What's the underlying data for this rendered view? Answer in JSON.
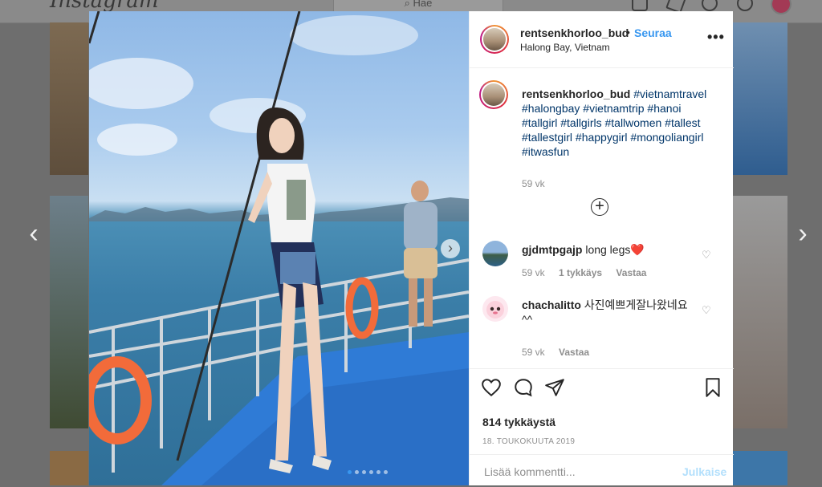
{
  "app": {
    "logo": "Instagram",
    "search_placeholder": "Hae"
  },
  "post": {
    "author": "rentsenkhorloo_bud",
    "follow_label": "Seuraa",
    "separator": "•",
    "location": "Halong Bay, Vietnam",
    "more_label": "•••",
    "carousel": {
      "total": 6,
      "active_index": 0
    },
    "caption": {
      "username": "rentsenkhorloo_bud",
      "hashtags": "#vietnamtravel #halongbay #vietnamtrip #hanoi #tallgirl #tallgirls #tallwomen #tallest #tallestgirl #happygirl #mongoliangirl #itwasfun",
      "time": "59 vk"
    },
    "comments": [
      {
        "username": "gjdmtpgajp",
        "text": "long legs❤️",
        "time": "59 vk",
        "likes": "1 tykkäys",
        "reply": "Vastaa"
      },
      {
        "username": "chachalitto",
        "text": "사진예쁘게잘나왔네요^^",
        "time": "59 vk",
        "reply": "Vastaa"
      }
    ],
    "likes_count": "814 tykkäystä",
    "date": "18. TOUKOKUUTA 2019",
    "comment_placeholder": "Lisää kommentti...",
    "publish_label": "Julkaise"
  },
  "icons": {
    "load_more": "plus-circle-icon",
    "like": "heart-icon",
    "comment": "comment-bubble-icon",
    "share": "paper-plane-icon",
    "save": "bookmark-icon",
    "prev": "chevron-left-icon",
    "next": "chevron-right-icon"
  },
  "colors": {
    "accent": "#3897f0",
    "hashtag": "#003569",
    "muted": "#8e8e8e",
    "heart": "#ed4956"
  }
}
